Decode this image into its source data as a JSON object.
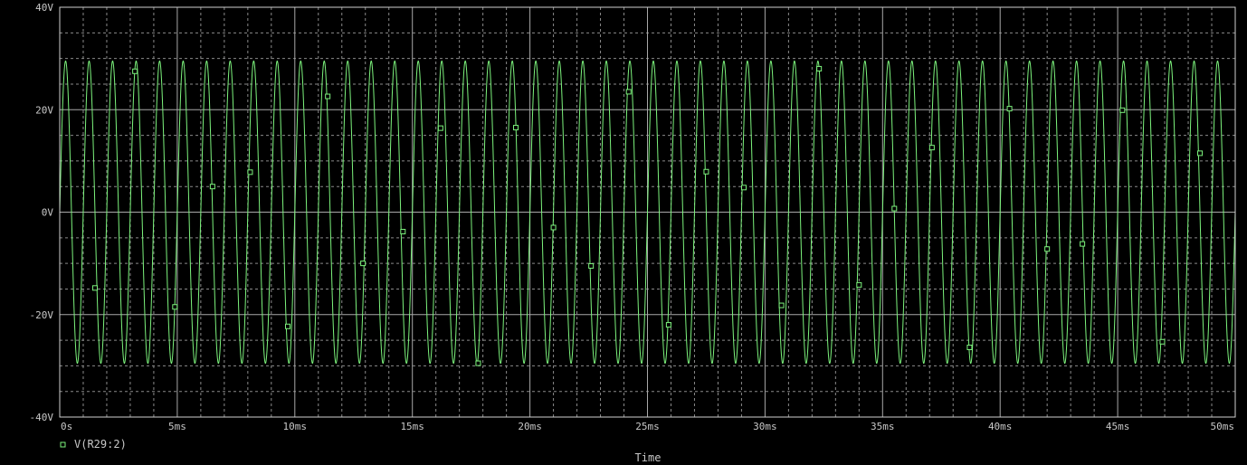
{
  "chart_data": {
    "type": "line",
    "title": "",
    "xlabel": "Time",
    "ylabel": "",
    "xlim": [
      0,
      50
    ],
    "ylim": [
      -40,
      40
    ],
    "x_unit": "ms",
    "y_unit": "V",
    "x_ticks": [
      0,
      5,
      10,
      15,
      20,
      25,
      30,
      35,
      40,
      45,
      50
    ],
    "x_tick_labels": [
      "0s",
      "5ms",
      "10ms",
      "15ms",
      "20ms",
      "25ms",
      "30ms",
      "35ms",
      "40ms",
      "45ms",
      "50ms"
    ],
    "y_ticks": [
      -40,
      -20,
      0,
      20,
      40
    ],
    "y_tick_labels": [
      "-40V",
      "-20V",
      "0V",
      "20V",
      "40V"
    ],
    "grid": true,
    "legend_position": "bottom-left",
    "series": [
      {
        "name": "V(R29:2)",
        "color": "#7cf27c",
        "waveform": "sine",
        "amplitude": 29.5,
        "frequency_khz": 1,
        "markers": [
          [
            1.5,
            -14.8
          ],
          [
            3.2,
            27.5
          ],
          [
            4.9,
            -18.5
          ],
          [
            6.5,
            5.0
          ],
          [
            8.1,
            7.8
          ],
          [
            9.7,
            -22.3
          ],
          [
            11.4,
            22.6
          ],
          [
            12.9,
            -10.0
          ],
          [
            14.6,
            -3.8
          ],
          [
            16.2,
            16.4
          ],
          [
            17.8,
            -29.5
          ],
          [
            19.4,
            16.5
          ],
          [
            21.0,
            -3.0
          ],
          [
            22.6,
            -10.5
          ],
          [
            24.2,
            23.5
          ],
          [
            25.9,
            -22.0
          ],
          [
            27.5,
            7.9
          ],
          [
            29.1,
            4.8
          ],
          [
            30.7,
            -18.2
          ],
          [
            32.3,
            28.0
          ],
          [
            34.0,
            -14.2
          ],
          [
            35.5,
            0.7
          ],
          [
            37.1,
            12.6
          ],
          [
            38.7,
            -26.4
          ],
          [
            40.4,
            20.2
          ],
          [
            42.0,
            -7.2
          ],
          [
            43.5,
            -6.2
          ],
          [
            45.2,
            19.9
          ],
          [
            46.9,
            -25.3
          ],
          [
            48.5,
            11.5
          ]
        ]
      }
    ]
  }
}
